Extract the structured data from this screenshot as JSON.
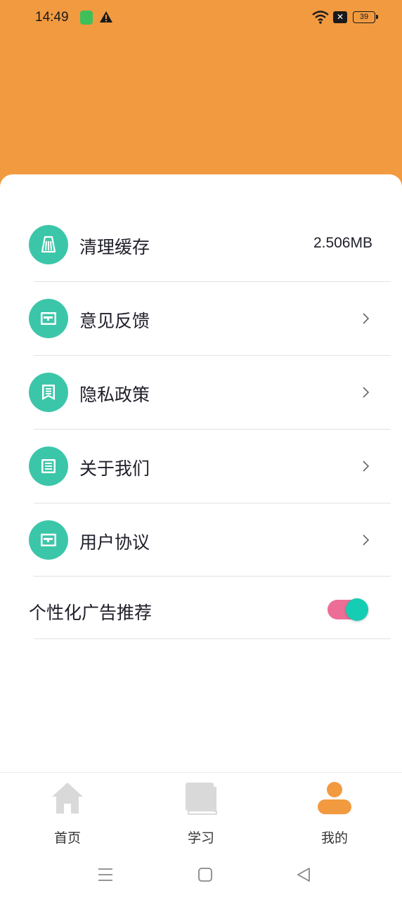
{
  "status_bar": {
    "time": "14:49",
    "battery": "39",
    "icons": [
      "app-notification-icon",
      "warning-icon",
      "wifi-icon",
      "no-sim-icon",
      "battery-icon"
    ]
  },
  "colors": {
    "header": "#F29A40",
    "icon_circle": "#3CC6A9",
    "toggle_track": "#EC6E96",
    "toggle_knob": "#14CDB3",
    "tab_active": "#F29A40",
    "tab_inactive": "#D9D9D9"
  },
  "settings": {
    "items": [
      {
        "label": "清理缓存",
        "value": "2.506MB",
        "icon": "broom-icon"
      },
      {
        "label": "意见反馈",
        "icon": "feedback-icon"
      },
      {
        "label": "隐私政策",
        "icon": "policy-icon"
      },
      {
        "label": "关于我们",
        "icon": "about-icon"
      },
      {
        "label": "用户协议",
        "icon": "agreement-icon"
      }
    ],
    "ad_toggle": {
      "label": "个性化广告推荐",
      "on": true
    }
  },
  "tabs": [
    {
      "label": "首页",
      "icon": "home-icon",
      "active": false
    },
    {
      "label": "学习",
      "icon": "book-icon",
      "active": false
    },
    {
      "label": "我的",
      "icon": "profile-icon",
      "active": true
    }
  ],
  "nav": [
    "menu-nav-icon",
    "home-nav-icon",
    "back-nav-icon"
  ]
}
